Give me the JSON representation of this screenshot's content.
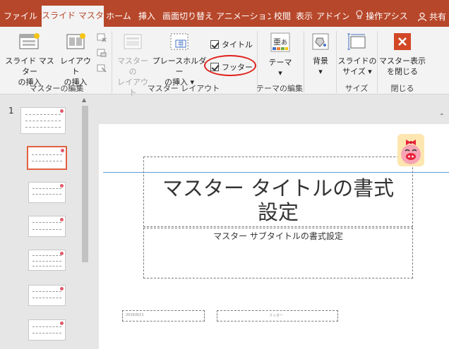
{
  "tabs": [
    "ファイル",
    "スライド マスター",
    "ホーム",
    "挿入",
    "画面切り替え",
    "アニメーション",
    "校閲",
    "表示",
    "アドイン"
  ],
  "tell_me": "操作アシス",
  "share": "共有",
  "ribbon": {
    "insert_master": [
      "スライド マスター",
      "の挿入"
    ],
    "insert_layout": [
      "レイアウト",
      "の挿入"
    ],
    "master_layout": [
      "マスターの",
      "レイアウト"
    ],
    "insert_placeholder": [
      "プレースホルダー",
      "の挿入"
    ],
    "title_check": "タイトル",
    "footer_check": "フッター",
    "theme": "テーマ",
    "background": "背景",
    "slide_size": [
      "スライドの",
      "サイズ"
    ],
    "close_master": [
      "マスター表示",
      "を閉じる"
    ],
    "groups": {
      "master_edit": "マスターの編集",
      "master_layout": "マスター レイアウト",
      "theme_edit": "テーマの編集",
      "size": "サイズ",
      "close": "閉じる"
    }
  },
  "thumbnails": {
    "slide_number": "1",
    "selected_index": 1,
    "count": 8
  },
  "slide": {
    "title": [
      "マスター タイトルの書式",
      "設定"
    ],
    "subtitle": "マスター サブタイトルの書式設定",
    "date": "2016/9/21",
    "footer": "フッター"
  },
  "colors": {
    "accent": "#b7472a",
    "highlight_circle": "#e0201a",
    "guide_line": "#5b9bd5"
  }
}
